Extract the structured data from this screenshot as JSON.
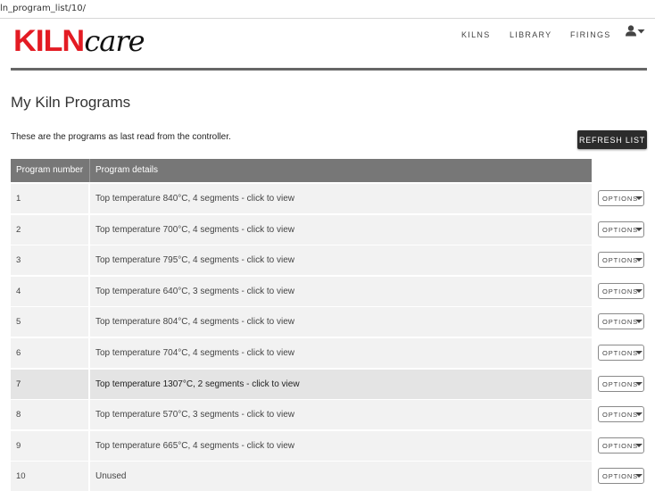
{
  "browser": {
    "url": "ln_program_list/10/"
  },
  "header": {
    "logo_kiln": "KILN",
    "logo_care": "care",
    "nav": [
      {
        "label": "KILNS"
      },
      {
        "label": "LIBRARY"
      },
      {
        "label": "FIRINGS"
      }
    ],
    "user_icon": "user-icon"
  },
  "main": {
    "title": "My Kiln Programs",
    "intro": "These are the programs as last read from the controller.",
    "refresh_label": "REFRESH LIST",
    "table": {
      "columns": [
        "Program number",
        "Program details"
      ],
      "options_label": "OPTIONS",
      "rows": [
        {
          "number": "1",
          "details": "Top temperature 840°C, 4 segments - click to view"
        },
        {
          "number": "2",
          "details": "Top temperature 700°C, 4 segments - click to view"
        },
        {
          "number": "3",
          "details": "Top temperature 795°C, 4 segments - click to view"
        },
        {
          "number": "4",
          "details": "Top temperature 640°C, 3 segments - click to view"
        },
        {
          "number": "5",
          "details": "Top temperature 804°C, 4 segments - click to view"
        },
        {
          "number": "6",
          "details": "Top temperature 704°C, 4 segments - click to view"
        },
        {
          "number": "7",
          "details": "Top temperature 1307°C, 2 segments - click to view",
          "highlighted": true
        },
        {
          "number": "8",
          "details": "Top temperature 570°C, 3 segments - click to view"
        },
        {
          "number": "9",
          "details": "Top temperature 665°C, 4 segments - click to view"
        },
        {
          "number": "10",
          "details": "Unused"
        }
      ]
    }
  },
  "colors": {
    "brand_red": "#e31b23",
    "header_rule": "#666666",
    "table_header": "#777777",
    "row_bg": "#f2f2f2",
    "row_highlight": "#e4e4e4",
    "button_dark": "#2b2b2b"
  }
}
